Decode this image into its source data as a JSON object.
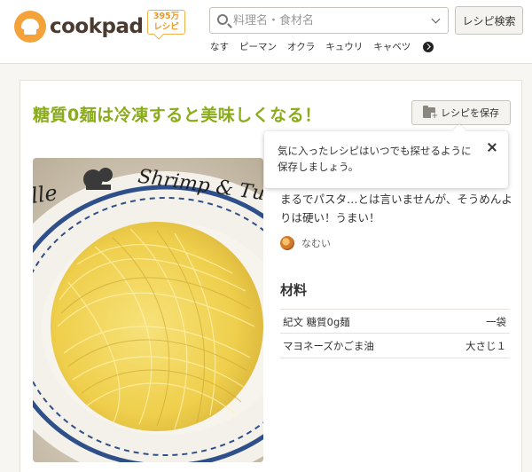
{
  "header": {
    "logo_text": "cookpad",
    "badge": {
      "line1": "395万",
      "line2": "レシピ"
    },
    "search_placeholder": "料理名・食材名",
    "search_button": "レシピ検索",
    "keywords": [
      "なす",
      "ピーマン",
      "オクラ",
      "キュウリ",
      "キャベツ"
    ]
  },
  "recipe": {
    "title": "糖質0麺は冷凍すると美味しくなる！",
    "save_button": "レシピを保存",
    "tooltip": "気に入ったレシピはいつでも探せるように保存しましょう。",
    "description": "まるでパスタ…とは言いませんが、そうめんよりは硬い！うまい！",
    "author": "なむい",
    "ingredients_heading": "材料",
    "ingredients": [
      {
        "name": "紀文 糖質0g麺",
        "qty": "一袋"
      },
      {
        "name": "マヨネーズかごま油",
        "qty": "大さじ１"
      }
    ]
  },
  "photo": {
    "plate_text": "Shrimp & Tu",
    "plate_text_left": "lle"
  },
  "colors": {
    "title": "#8aab1a",
    "brand": "#f3a33a",
    "noodle": "#f2d65a",
    "plate_rim": "#2e4f8a"
  }
}
